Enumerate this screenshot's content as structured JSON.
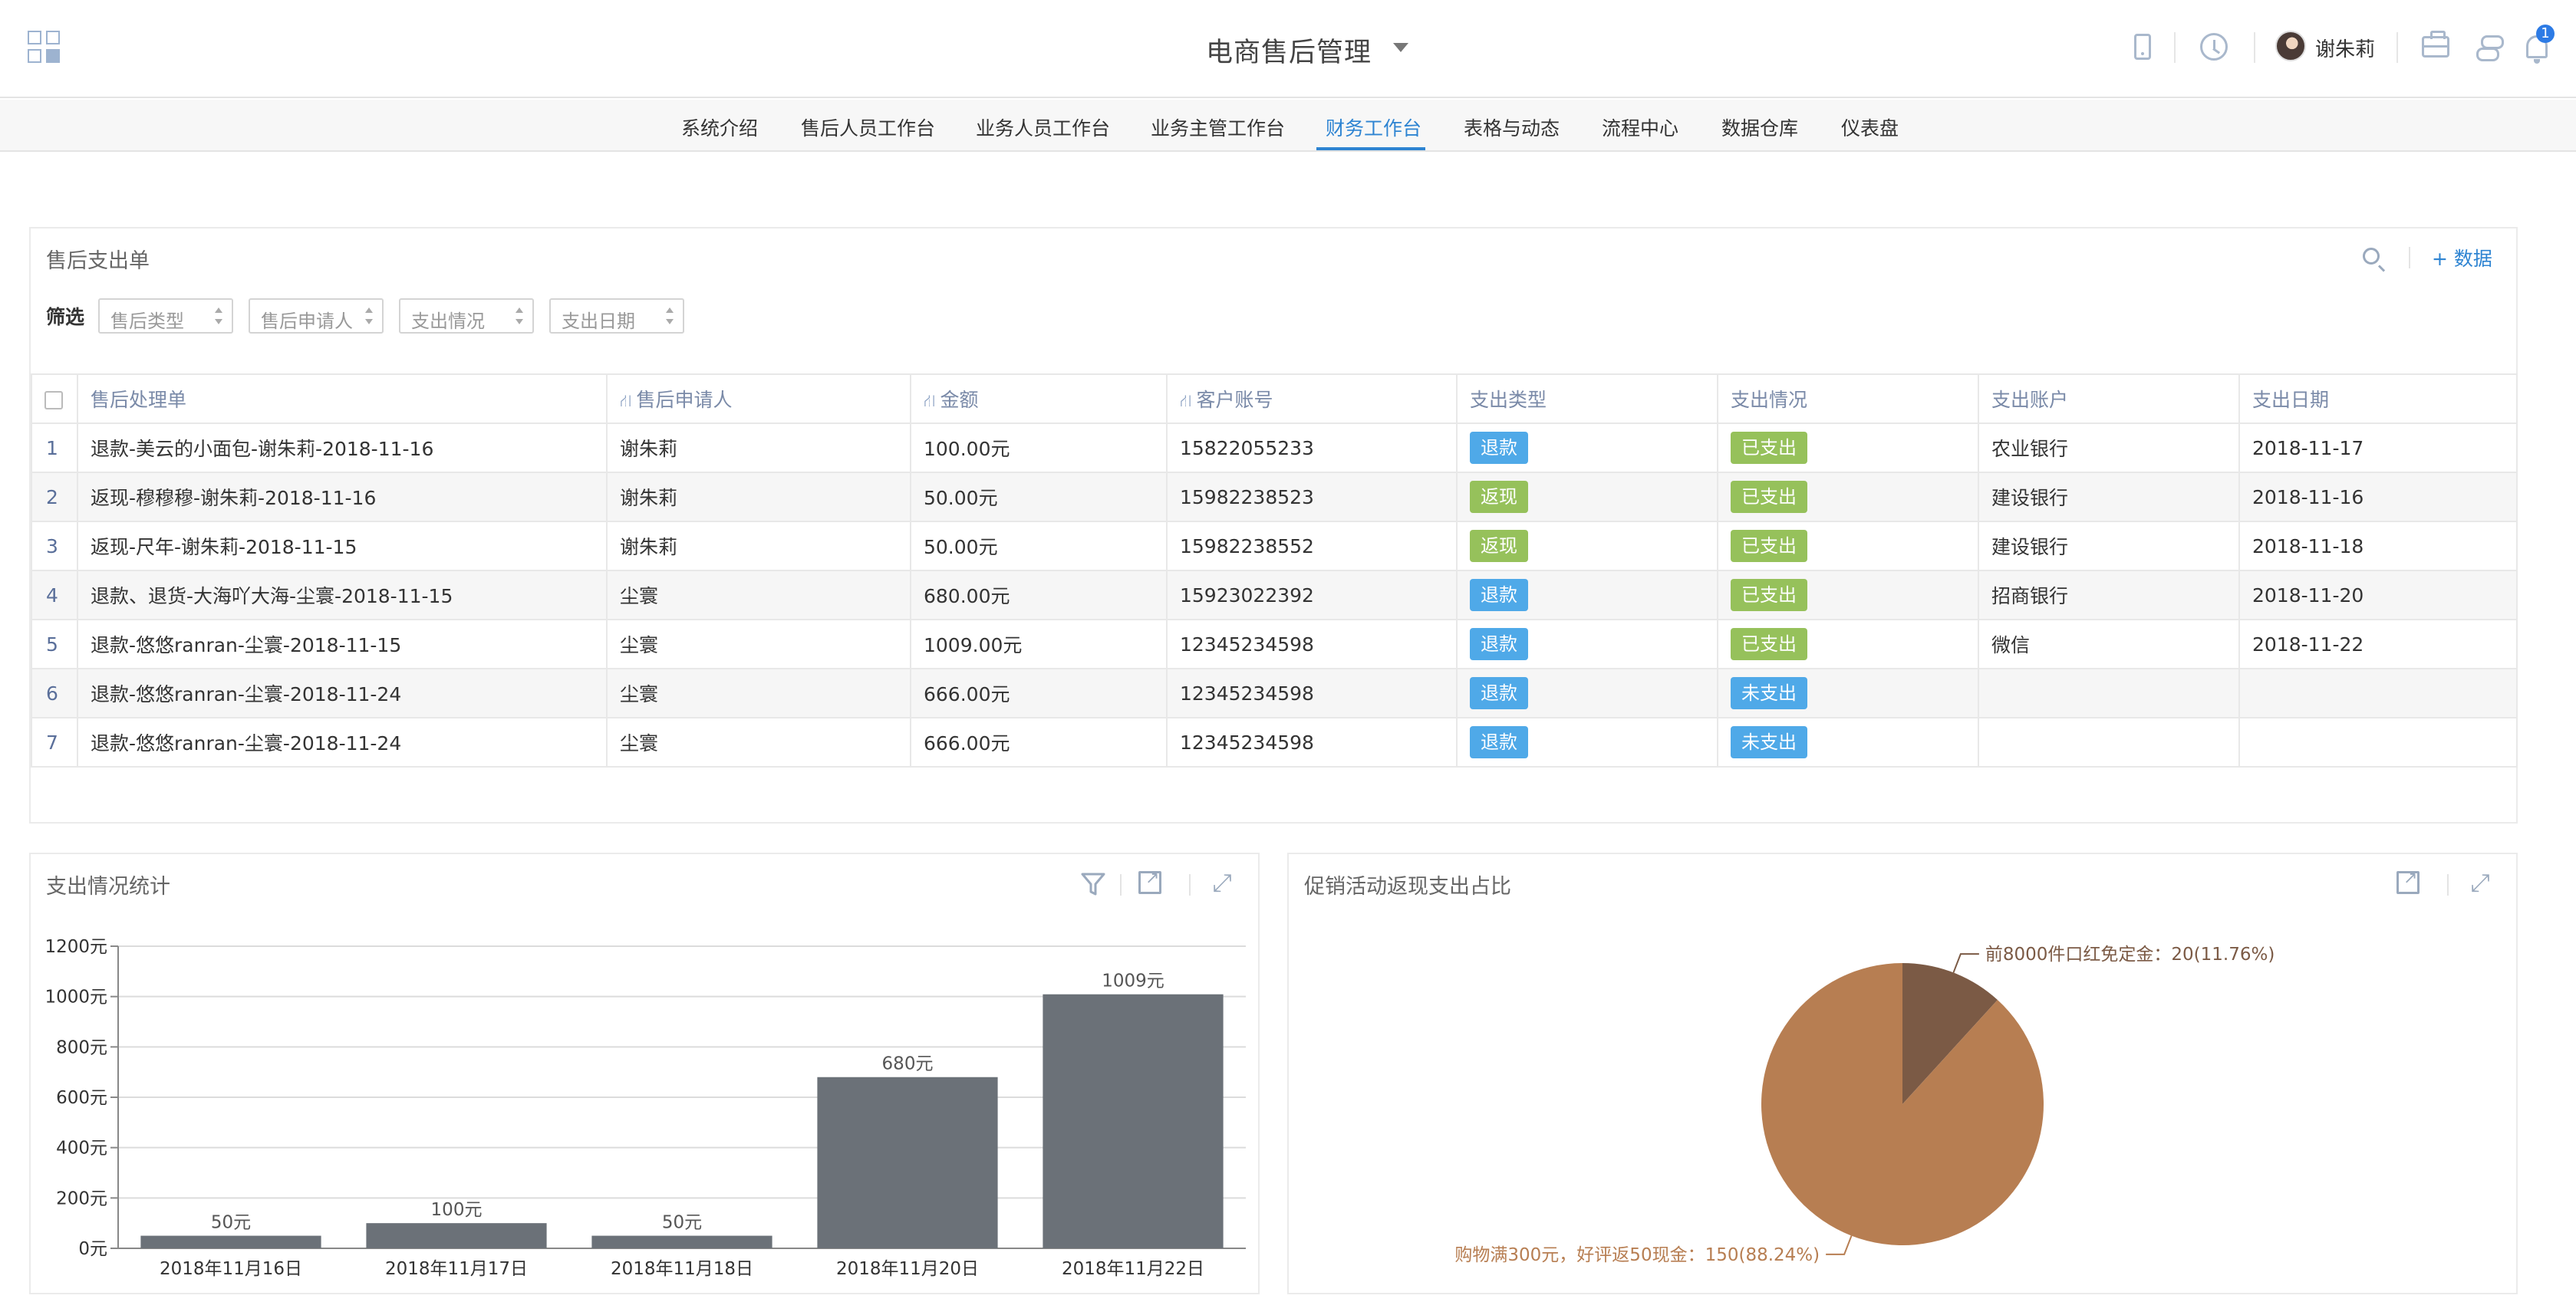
{
  "header": {
    "app_title": "电商售后管理",
    "user_name": "谢朱莉",
    "notification_count": "1",
    "icons": [
      "apps-grid-icon",
      "phone-icon",
      "clock-icon",
      "briefcase-icon",
      "flow-icon",
      "bell-icon"
    ]
  },
  "nav": {
    "items": [
      "系统介绍",
      "售后人员工作台",
      "业务人员工作台",
      "业务主管工作台",
      "财务工作台",
      "表格与动态",
      "流程中心",
      "数据仓库",
      "仪表盘"
    ],
    "active": "财务工作台"
  },
  "table_panel": {
    "title": "售后支出单",
    "add_label": "+ 数据",
    "filter_label": "筛选",
    "filters": [
      "售后类型",
      "售后申请人",
      "支出情况",
      "支出日期"
    ],
    "columns": [
      "售后处理单",
      "售后申请人",
      "金额",
      "客户账号",
      "支出类型",
      "支出情况",
      "支出账户",
      "支出日期"
    ],
    "rows": [
      {
        "idx": "1",
        "order": "退款-美云的小面包-谢朱莉-2018-11-16",
        "applicant": "谢朱莉",
        "amount": "100.00元",
        "account": "15822055233",
        "type": "退款",
        "status": "已支出",
        "pay_account": "农业银行",
        "date": "2018-11-17"
      },
      {
        "idx": "2",
        "order": "返现-穆穆穆-谢朱莉-2018-11-16",
        "applicant": "谢朱莉",
        "amount": "50.00元",
        "account": "15982238523",
        "type": "返现",
        "status": "已支出",
        "pay_account": "建设银行",
        "date": "2018-11-16"
      },
      {
        "idx": "3",
        "order": "返现-尺年-谢朱莉-2018-11-15",
        "applicant": "谢朱莉",
        "amount": "50.00元",
        "account": "15982238552",
        "type": "返现",
        "status": "已支出",
        "pay_account": "建设银行",
        "date": "2018-11-18"
      },
      {
        "idx": "4",
        "order": "退款、退货-大海吖大海-尘寰-2018-11-15",
        "applicant": "尘寰",
        "amount": "680.00元",
        "account": "15923022392",
        "type": "退款",
        "status": "已支出",
        "pay_account": "招商银行",
        "date": "2018-11-20"
      },
      {
        "idx": "5",
        "order": "退款-悠悠ranran-尘寰-2018-11-15",
        "applicant": "尘寰",
        "amount": "1009.00元",
        "account": "12345234598",
        "type": "退款",
        "status": "已支出",
        "pay_account": "微信",
        "date": "2018-11-22"
      },
      {
        "idx": "6",
        "order": "退款-悠悠ranran-尘寰-2018-11-24",
        "applicant": "尘寰",
        "amount": "666.00元",
        "account": "12345234598",
        "type": "退款",
        "status": "未支出",
        "pay_account": "",
        "date": ""
      },
      {
        "idx": "7",
        "order": "退款-悠悠ranran-尘寰-2018-11-24",
        "applicant": "尘寰",
        "amount": "666.00元",
        "account": "12345234598",
        "type": "退款",
        "status": "未支出",
        "pay_account": "",
        "date": ""
      }
    ],
    "colors": {
      "tag_blue": "#4fa9e8",
      "tag_green": "#96c15b",
      "accent": "#2e84d2"
    }
  },
  "bar_panel": {
    "title": "支出情况统计"
  },
  "pie_panel": {
    "title": "促销活动返现支出占比"
  },
  "chart_data": [
    {
      "type": "bar",
      "title": "支出情况统计",
      "categories": [
        "2018年11月16日",
        "2018年11月17日",
        "2018年11月18日",
        "2018年11月20日",
        "2018年11月22日"
      ],
      "values": [
        50,
        100,
        50,
        680,
        1009
      ],
      "data_labels": [
        "50元",
        "100元",
        "50元",
        "680元",
        "1009元"
      ],
      "yticks": [
        "0元",
        "200元",
        "400元",
        "600元",
        "800元",
        "1000元",
        "1200元"
      ],
      "ylim": [
        0,
        1200
      ],
      "grid": true,
      "bar_color": "#6b7178"
    },
    {
      "type": "pie",
      "title": "促销活动返现支出占比",
      "slices": [
        {
          "label": "前8000件口红免定金：20(11.76%)",
          "value": 20,
          "color": "#7b5a45"
        },
        {
          "label": "购物满300元，好评返50现金：150(88.24%)",
          "value": 150,
          "color": "#b77e52"
        }
      ]
    }
  ]
}
